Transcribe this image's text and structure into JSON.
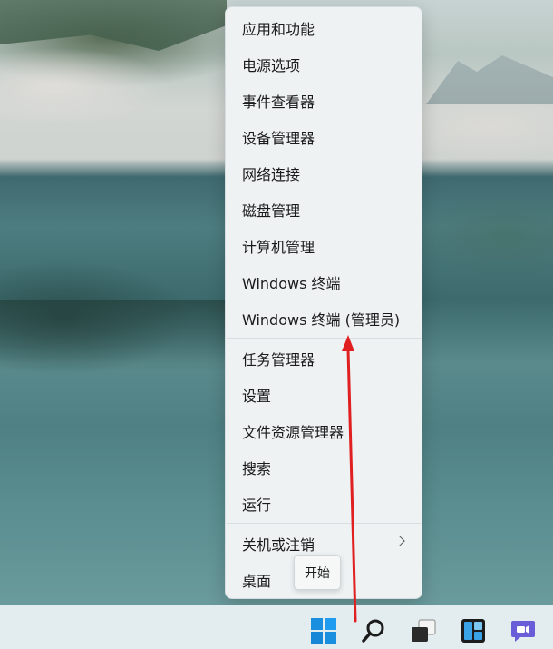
{
  "context_menu": {
    "items": [
      {
        "label": "应用和功能"
      },
      {
        "label": "电源选项"
      },
      {
        "label": "事件查看器"
      },
      {
        "label": "设备管理器"
      },
      {
        "label": "网络连接"
      },
      {
        "label": "磁盘管理"
      },
      {
        "label": "计算机管理"
      },
      {
        "label": "Windows 终端"
      },
      {
        "label": "Windows 终端 (管理员)"
      },
      {
        "label": "任务管理器"
      },
      {
        "label": "设置"
      },
      {
        "label": "文件资源管理器"
      },
      {
        "label": "搜索"
      },
      {
        "label": "运行"
      },
      {
        "label": "关机或注销"
      },
      {
        "label": "桌面"
      }
    ]
  },
  "tooltip": {
    "text": "开始"
  },
  "taskbar": {
    "icons": [
      "windows-start-icon",
      "search-icon",
      "task-view-icon",
      "widgets-icon",
      "teams-chat-icon"
    ]
  },
  "annotation": {
    "arrow_color": "#e02020"
  }
}
